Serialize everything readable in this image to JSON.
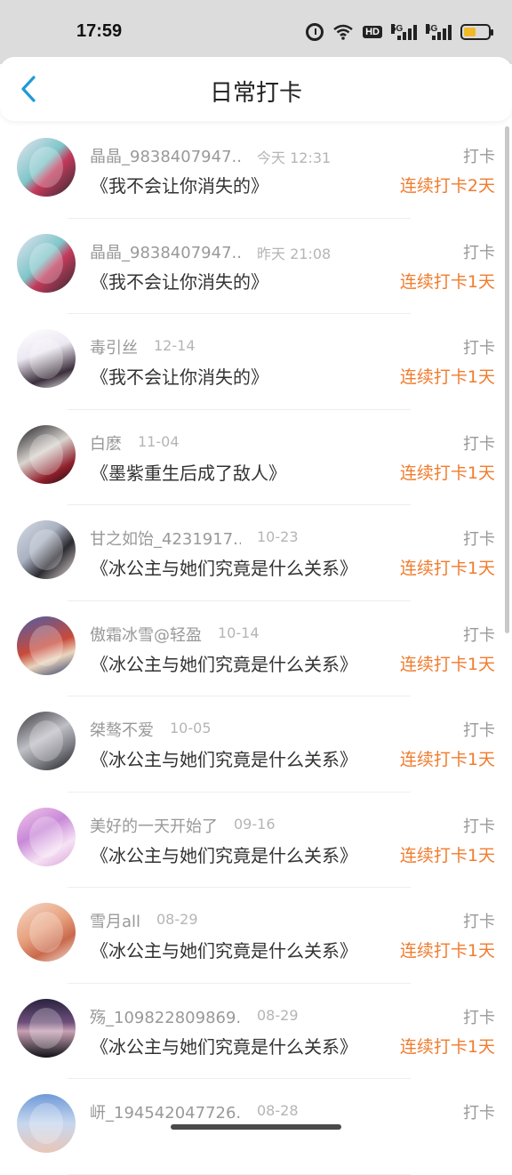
{
  "status_bar": {
    "time": "17:59",
    "icons": [
      "alarm-icon",
      "wifi-icon",
      "hd-icon",
      "signal-5g-icon",
      "signal-4g-icon",
      "battery-icon"
    ],
    "hd_label": "HD",
    "sig1_label": "5G",
    "sig2_label": "4G",
    "battery_level": 0.5,
    "battery_color": "#f2b92a"
  },
  "header": {
    "title": "日常打卡",
    "back_icon": "chevron-left-icon",
    "accent": "#1e9bd7"
  },
  "entries": [
    {
      "name": "晶晶_9838407947...",
      "time": "今天 12:31",
      "book": "《我不会让你消失的》",
      "checkin": "打卡",
      "streak": "连续打卡2天",
      "avatar": "linear-gradient(135deg,#e8e4f0,#7ec6c9 45%,#c53a5b 60%,#2a2a33)"
    },
    {
      "name": "晶晶_9838407947...",
      "time": "昨天 21:08",
      "book": "《我不会让你消失的》",
      "checkin": "打卡",
      "streak": "连续打卡1天",
      "avatar": "linear-gradient(135deg,#e8e4f0,#7ec6c9 45%,#c53a5b 60%,#2a2a33)"
    },
    {
      "name": "毒引丝",
      "time": "12-14",
      "book": "《我不会让你消失的》",
      "checkin": "打卡",
      "streak": "连续打卡1天",
      "avatar": "linear-gradient(160deg,#ffffff,#ece8f2 40%,#3a2d3a 75%,#f0f0f0)"
    },
    {
      "name": "白麽",
      "time": "11-04",
      "book": "《墨紫重生后成了敌人》",
      "checkin": "打卡",
      "streak": "连续打卡1天",
      "avatar": "linear-gradient(150deg,#1b1b1f,#d9d4cf 45%,#8f1f2b 75%,#111)"
    },
    {
      "name": "甘之如饴_4231917...",
      "time": "10-23",
      "book": "《冰公主与她们究竟是什么关系》",
      "checkin": "打卡",
      "streak": "连续打卡1天",
      "avatar": "linear-gradient(135deg,#d7dbe4,#a9b2c2 40%,#2b2a30 65%,#f1e8e4)"
    },
    {
      "name": "傲霜冰雪@轻盈",
      "time": "10-14",
      "book": "《冰公主与她们究竟是什么关系》",
      "checkin": "打卡",
      "streak": "连续打卡1天",
      "avatar": "linear-gradient(160deg,#4b5fa8,#c94a3b 50%,#e9d5bd 70%,#2a3766)"
    },
    {
      "name": "桀骜不爱",
      "time": "10-05",
      "book": "《冰公主与她们究竟是什么关系》",
      "checkin": "打卡",
      "streak": "连续打卡1天",
      "avatar": "linear-gradient(150deg,#3a3a3e,#bfbfc6 45%,#7d7d85 70%,#1d1d21)"
    },
    {
      "name": "美好的一天开始了",
      "time": "09-16",
      "book": "《冰公主与她们究竟是什么关系》",
      "checkin": "打卡",
      "streak": "连续打卡1天",
      "avatar": "linear-gradient(150deg,#f3c8ea,#c889d8 40%,#f6e2f4 70%,#d9a0d8)"
    },
    {
      "name": "雪月all",
      "time": "08-29",
      "book": "《冰公主与她们究竟是什么关系》",
      "checkin": "打卡",
      "streak": "连续打卡1天",
      "avatar": "linear-gradient(150deg,#f6d8c8,#e7a17f 45%,#c9694c 70%,#f3e3d8)"
    },
    {
      "name": "殇_109822809869...",
      "time": "08-29",
      "book": "《冰公主与她们究竟是什么关系》",
      "checkin": "打卡",
      "streak": "连续打卡1天",
      "avatar": "linear-gradient(180deg,#2a2340,#6d4f7a 40%,#c7a0b4 55%,#111218)"
    },
    {
      "name": "岍_194542047726...",
      "time": "08-28",
      "book": "",
      "checkin": "打卡",
      "streak": "",
      "avatar": "linear-gradient(180deg,#6f9ad8,#c6d7ee 50%,#e8c6b8)"
    }
  ]
}
